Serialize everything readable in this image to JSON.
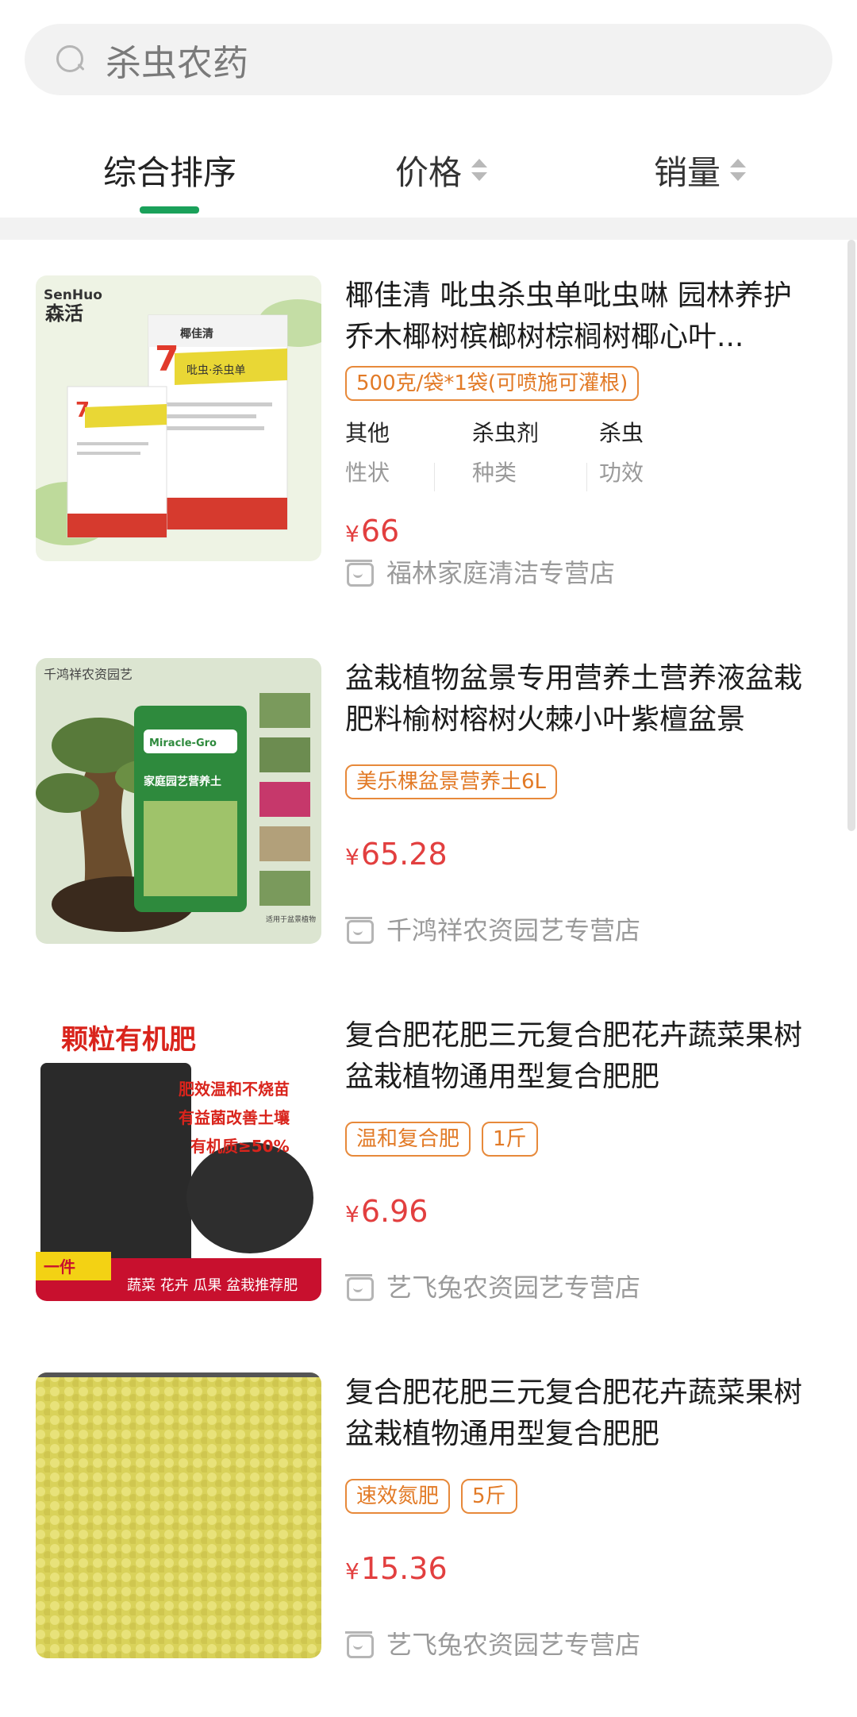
{
  "search": {
    "query": "杀虫农药"
  },
  "sort": {
    "tabs": [
      {
        "label": "综合排序"
      },
      {
        "label": "价格"
      },
      {
        "label": "销量"
      }
    ]
  },
  "products": [
    {
      "title": "椰佳清 吡虫杀虫单吡虫啉 园林养护乔木椰树槟榔树棕榈树椰心叶...",
      "tags": [
        "500克/袋*1袋(可喷施可灌根)"
      ],
      "attrs": [
        {
          "value": "其他",
          "key": "性状"
        },
        {
          "value": "杀虫剂",
          "key": "种类"
        },
        {
          "value": "杀虫",
          "key": "功效"
        }
      ],
      "price_currency": "¥",
      "price_value": "66",
      "store": "福林家庭清洁专营店",
      "image_text": {
        "brand_en": "SenHuo",
        "brand_cn": "森活",
        "product": "椰佳清",
        "band": "吡虫·杀虫单"
      }
    },
    {
      "title": "盆栽植物盆景专用营养土营养液盆栽肥料榆树榕树火棘小叶紫檀盆景",
      "tags": [
        "美乐棵盆景营养土6L"
      ],
      "price_currency": "¥",
      "price_value": "65.28",
      "store": "千鸿祥农资园艺专营店",
      "image_text": {
        "shop": "千鸿祥农资园艺",
        "bag_brand": "Miracle-Gro",
        "bag_label": "家庭园艺营养土",
        "side_note": "适用于盆景植物"
      }
    },
    {
      "title": "复合肥花肥三元复合肥花卉蔬菜果树盆栽植物通用型复合肥肥",
      "tags": [
        "温和复合肥",
        "1斤"
      ],
      "price_currency": "¥",
      "price_value": "6.96",
      "store": "艺飞兔农资园艺专营店",
      "image_text": {
        "headline": "颗粒有机肥",
        "line1": "肥效温和不烧苗",
        "line2": "有益菌改善土壤",
        "line3": "有机质≥50%",
        "badge": "一件",
        "bottom": "蔬菜 花卉 瓜果 盆栽推荐肥"
      }
    },
    {
      "title": "复合肥花肥三元复合肥花卉蔬菜果树盆栽植物通用型复合肥肥",
      "tags": [
        "速效氮肥",
        "5斤"
      ],
      "price_currency": "¥",
      "price_value": "15.36",
      "store": "艺飞兔农资园艺专营店"
    }
  ]
}
